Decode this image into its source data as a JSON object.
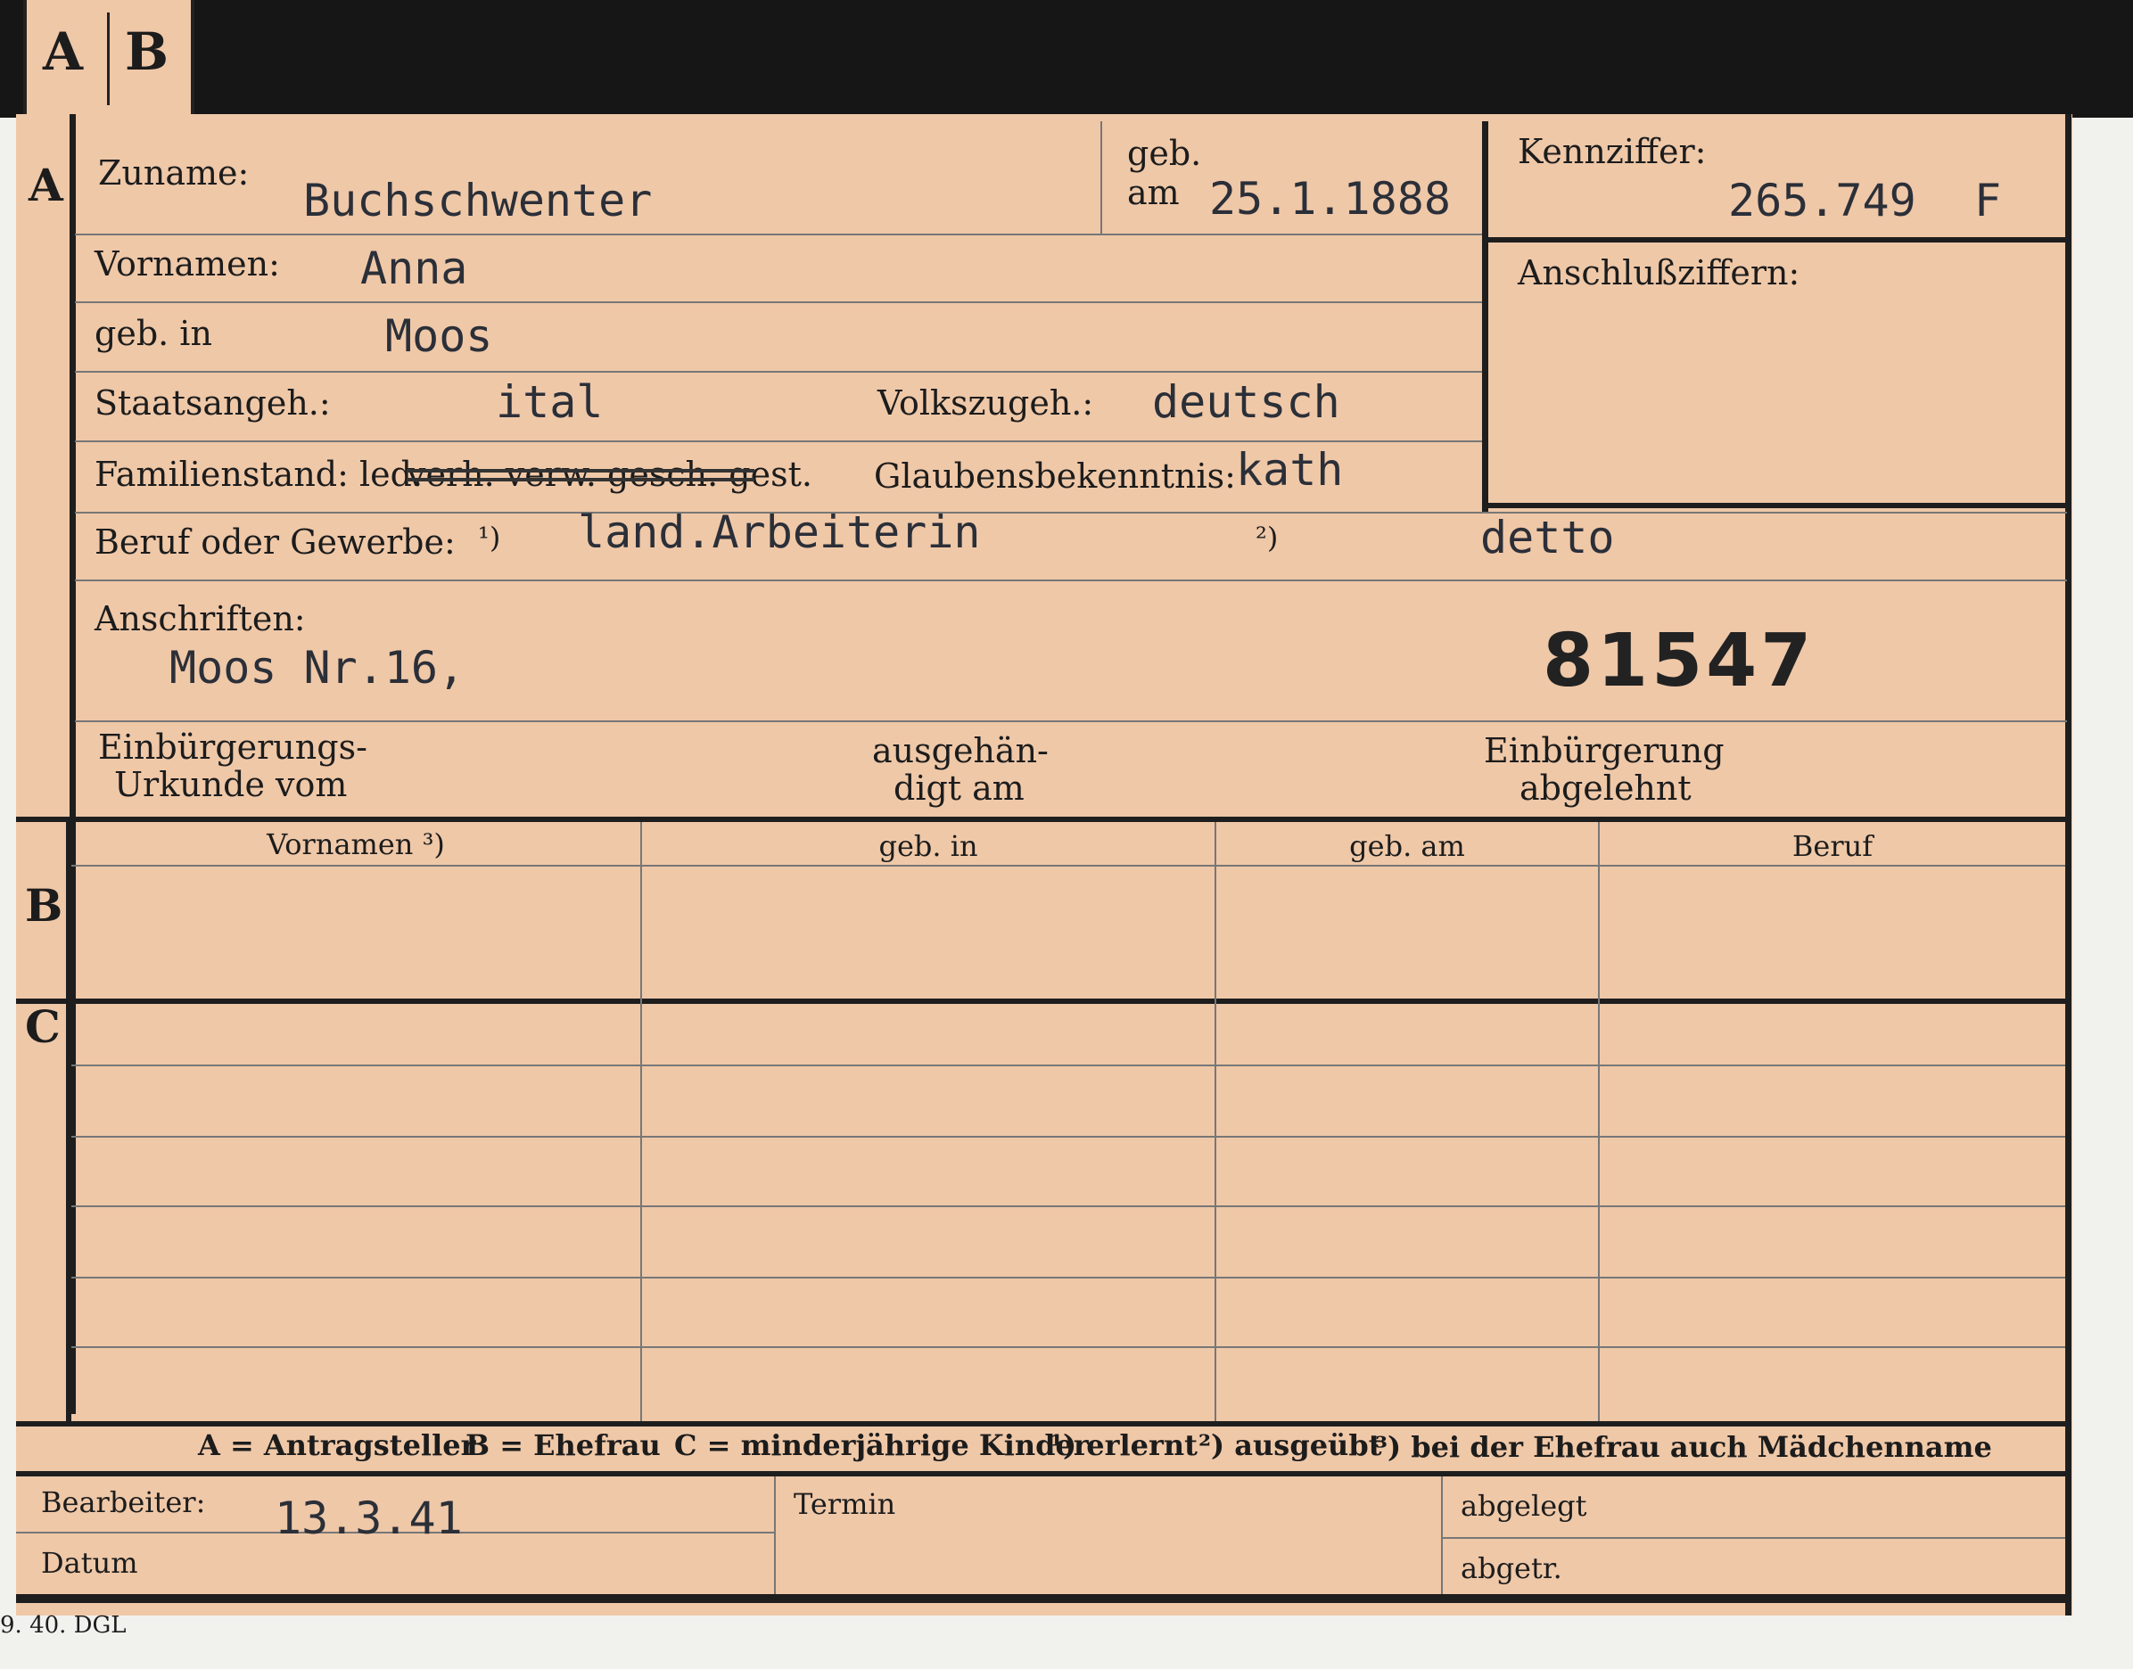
{
  "tab": {
    "a": "A",
    "b": "B"
  },
  "sections": {
    "a": "A",
    "b": "B",
    "c": "C"
  },
  "applicant": {
    "surname_label": "Zuname:",
    "surname": "Buchschwenter",
    "born_label_1": "geb.",
    "born_label_2": "am",
    "birth_date": "25.1.1888",
    "firstname_label": "Vornamen:",
    "firstname": "Anna",
    "birthplace_label": "geb. in",
    "birthplace": "Moos",
    "citizenship_label": "Staatsangeh.:",
    "citizenship": "ital",
    "ethnicity_label": "Volkszugeh.:",
    "ethnicity": "deutsch",
    "marital_label": "Familienstand: led.",
    "marital_crossed": "verh. verw. gesch. gest.",
    "religion_label": "Glaubensbekenntnis:",
    "religion": "kath",
    "occupation_label": "Beruf oder Gewerbe:",
    "occupation_mark_1": "¹)",
    "occupation_1": "land.Arbeiterin",
    "occupation_mark_2": "²)",
    "occupation_2": "detto",
    "address_label": "Anschriften:",
    "address": "Moos Nr.16,",
    "stamp_number": "81547",
    "naturalization_label_1": "Einbürgerungs-",
    "naturalization_label_2": "Urkunde vom",
    "handed_label_1": "ausgehän-",
    "handed_label_2": "digt am",
    "refused_label_1": "Einbürgerung",
    "refused_label_2": "abgelehnt"
  },
  "id_box": {
    "id_label": "Kennziffer:",
    "id_value": "265.749",
    "id_suffix": "F",
    "linked_label": "Anschlußziffern:"
  },
  "table": {
    "headers": [
      "Vornamen ³)",
      "geb. in",
      "geb. am",
      "Beruf"
    ]
  },
  "legend": {
    "a": "A = Antragsteller",
    "b": "B = Ehefrau",
    "c": "C = minderjährige Kinder",
    "n1": "¹) erlernt",
    "n2": "²) ausgeübt",
    "n3": "³) bei der Ehefrau auch Mädchenname"
  },
  "footer": {
    "editor_label": "Bearbeiter:",
    "editor_date": "13.3.41",
    "date_label": "Datum",
    "deadline_label": "Termin",
    "filed_label": "abgelegt",
    "removed_label": "abgetr."
  },
  "imprint": "9. 40. DGL"
}
